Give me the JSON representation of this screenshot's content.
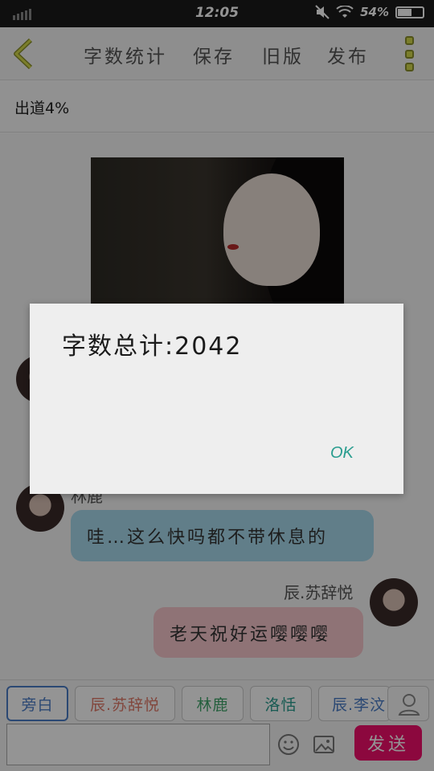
{
  "status_bar": {
    "time": "12:05",
    "battery_text": "54%",
    "battery_level": 0.54
  },
  "app_bar": {
    "word_count_label": "字数统计",
    "save_label": "保存",
    "old_version_label": "旧版",
    "publish_label": "发布",
    "icons": {
      "back": "chevron-left-icon",
      "more": "more-vertical-icon"
    },
    "accent_color": "#c9c92a"
  },
  "chapter": {
    "title": "出道4%"
  },
  "messages": [
    {
      "speaker": "林鹿",
      "text": "哇…这么快吗都不带休息的",
      "side": "left",
      "color": "#a8d9ec"
    },
    {
      "speaker": "辰.苏辞悦",
      "text": "老天祝好运嘤嘤嘤",
      "side": "right",
      "color": "#f7c7cc"
    }
  ],
  "dialog": {
    "message": "字数总计:2042",
    "ok_label": "OK"
  },
  "bottom": {
    "characters": [
      {
        "label": "旁白",
        "color": "#4b7dc7",
        "active": true
      },
      {
        "label": "辰.苏辞悦",
        "color": "#e07a6a",
        "active": false
      },
      {
        "label": "林鹿",
        "color": "#3fa46a",
        "active": false
      },
      {
        "label": "洛恬",
        "color": "#2a9d8f",
        "active": false
      },
      {
        "label": "辰.李汶",
        "color": "#4b7dc7",
        "active": false
      }
    ],
    "input_placeholder": "",
    "send_label": "发送",
    "send_color": "#f20f6c",
    "icons": {
      "emoji": "smiley-icon",
      "image": "image-icon",
      "person": "person-icon"
    }
  }
}
